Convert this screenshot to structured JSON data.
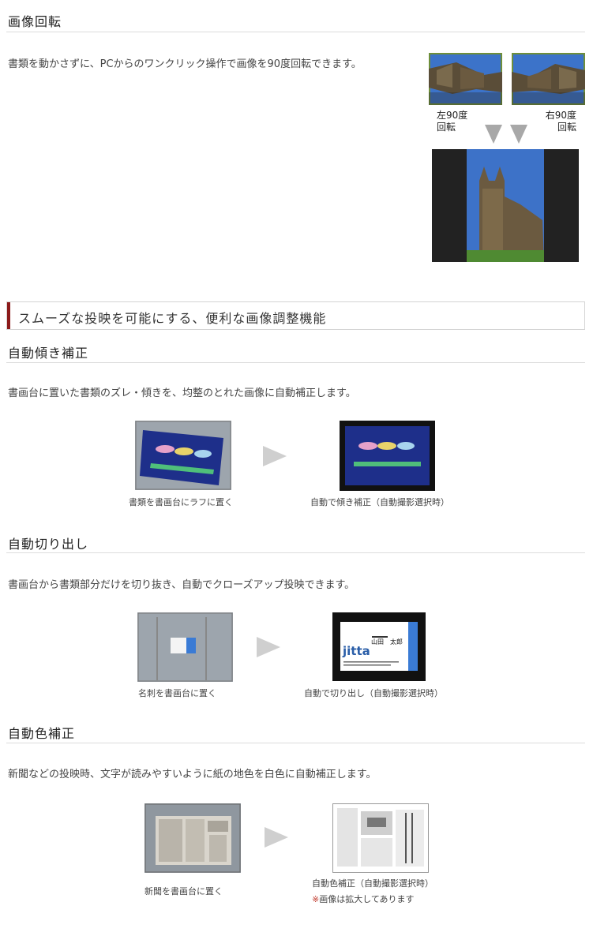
{
  "rotation": {
    "heading": "画像回転",
    "description": "書類を動かさずに、PCからのワンクリック操作で画像を90度回転できます。",
    "left_label_1": "左90度",
    "left_label_2": "回転",
    "right_label_1": "右90度",
    "right_label_2": "回転"
  },
  "banner": {
    "title": "スムーズな投映を可能にする、便利な画像調整機能"
  },
  "skew": {
    "heading": "自動傾き補正",
    "description": "書画台に置いた書類のズレ・傾きを、均整のとれた画像に自動補正します。",
    "caption_before": "書類を書画台にラフに置く",
    "caption_after": "自動で傾き補正（自動撮影選択時）"
  },
  "crop": {
    "heading": "自動切り出し",
    "description": "書画台から書類部分だけを切り抜き、自動でクローズアップ投映できます。",
    "caption_before": "名刺を書画台に置く",
    "caption_after": "自動で切り出し（自動撮影選択時）",
    "card_name": "山田　太郎",
    "card_logo": "jitta"
  },
  "color": {
    "heading": "自動色補正",
    "description": "新聞などの投映時、文字が読みやすいように紙の地色を白色に自動補正します。",
    "caption_before": "新聞を書画台に置く",
    "caption_after": "自動色補正（自動撮影選択時）",
    "note_mark": "※",
    "note_text": "画像は拡大してあります"
  },
  "colors": {
    "accent": "#8b1a1a",
    "note_red": "#c0392b"
  }
}
